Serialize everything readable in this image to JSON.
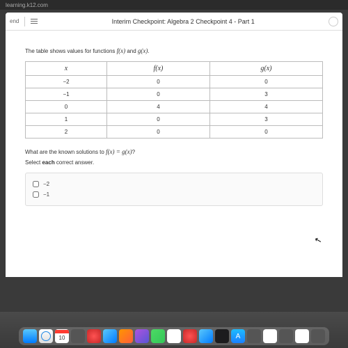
{
  "url": "learning.k12.com",
  "toolbar": {
    "left_label": "end",
    "title": "Interim Checkpoint: Algebra 2 Checkpoint 4 - Part 1"
  },
  "prompt_pre": "The table shows values for functions ",
  "prompt_f": "f(x)",
  "prompt_and": " and ",
  "prompt_g": "g(x)",
  "prompt_post": ".",
  "headers": {
    "x": "x",
    "fx": "f(x)",
    "gx": "g(x)"
  },
  "rows": [
    {
      "x": "−2",
      "fx": "0",
      "gx": "0"
    },
    {
      "x": "−1",
      "fx": "0",
      "gx": "3"
    },
    {
      "x": "0",
      "fx": "4",
      "gx": "4"
    },
    {
      "x": "1",
      "fx": "0",
      "gx": "3"
    },
    {
      "x": "2",
      "fx": "0",
      "gx": "0"
    }
  ],
  "question_pre": "What are the known solutions to ",
  "question_eq": "f(x) = g(x)",
  "question_post": "?",
  "instruction_pre": "Select ",
  "instruction_bold": "each",
  "instruction_post": " correct answer.",
  "answers": [
    {
      "label": "−2"
    },
    {
      "label": "−1"
    }
  ],
  "calendar_day": "10",
  "appstore_glyph": "A"
}
